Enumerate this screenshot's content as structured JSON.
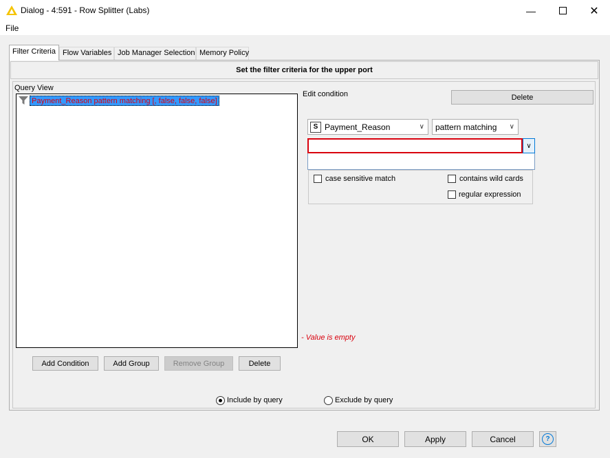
{
  "window": {
    "title": "Dialog - 4:591 - Row Splitter (Labs)"
  },
  "menu": {
    "file": "File"
  },
  "tabs": [
    "Filter Criteria",
    "Flow Variables",
    "Job Manager Selection",
    "Memory Policy"
  ],
  "header": {
    "text": "Set the filter criteria for the upper port"
  },
  "query_view": {
    "label": "Query View",
    "node_text": "Payment_Reason pattern matching [, false, false, false]"
  },
  "edit": {
    "label": "Edit condition",
    "delete_label": "Delete",
    "column_type": "S",
    "column_value": "Payment_Reason",
    "operator_value": "pattern matching",
    "pattern_value": "",
    "case_sensitive": "case sensitive match",
    "wildcards": "contains wild cards",
    "regex": "regular expression",
    "error": "- Value is empty"
  },
  "buttons": {
    "add_condition": "Add Condition",
    "add_group": "Add Group",
    "remove_group": "Remove Group",
    "delete": "Delete"
  },
  "radios": {
    "include": "Include by query",
    "exclude": "Exclude by query"
  },
  "footer": {
    "ok": "OK",
    "apply": "Apply",
    "cancel": "Cancel",
    "help": "?"
  },
  "colors": {
    "accent": "#0078d7",
    "error": "#d9000d",
    "selection": "#3399ff",
    "knime_yellow": "#f5c400"
  }
}
